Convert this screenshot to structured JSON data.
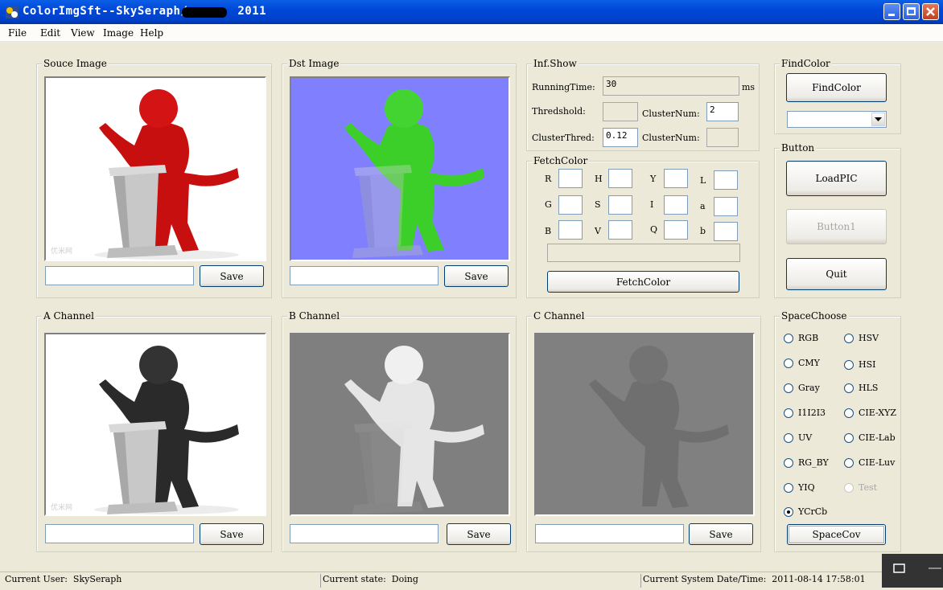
{
  "window": {
    "title_prefix": "ColorImgSft--SkySeraph/",
    "title_suffix": "2011"
  },
  "menu": [
    "File",
    "Edit",
    "View",
    "Image",
    "Help"
  ],
  "panels": {
    "source": {
      "label": "Souce Image",
      "save": "Save"
    },
    "dst": {
      "label": "Dst Image",
      "save": "Save"
    },
    "a": {
      "label": "A Channel",
      "save": "Save"
    },
    "b": {
      "label": "B Channel",
      "save": "Save"
    },
    "c": {
      "label": "C Channel",
      "save": "Save"
    }
  },
  "watermark": "优米网",
  "inf": {
    "label": "Inf.Show",
    "running_time_label": "RunningTime:",
    "running_time_value": "30",
    "running_time_unit": "ms",
    "threshold_label": "Thredshold:",
    "cluster_num_label": "ClusterNum:",
    "cluster_num_value": "2",
    "cluster_thred_label": "ClusterThred:",
    "cluster_thred_value": "0.12",
    "cluster_num2_label": "ClusterNum:"
  },
  "fetch": {
    "label": "FetchColor",
    "letters": [
      "R",
      "H",
      "Y",
      "L",
      "G",
      "S",
      "I",
      "a",
      "B",
      "V",
      "Q",
      "b"
    ],
    "button": "FetchColor"
  },
  "findcolor": {
    "label": "FindColor",
    "button": "FindColor"
  },
  "buttons": {
    "label": "Button",
    "load": "LoadPIC",
    "button1": "Button1",
    "quit": "Quit"
  },
  "space": {
    "label": "SpaceChoose",
    "options": [
      "RGB",
      "HSV",
      "CMY",
      "HSI",
      "Gray",
      "HLS",
      "I1I2I3",
      "CIE-XYZ",
      "UV",
      "CIE-Lab",
      "RG_BY",
      "CIE-Luv",
      "YIQ",
      "Test",
      "YCrCb"
    ],
    "selected": "YCrCb",
    "button": "SpaceCov"
  },
  "status": {
    "user_label": "Current User:",
    "user": "SkySeraph",
    "state_label": "Current state:",
    "state": "Doing",
    "datetime_label": "Current System Date/Time:",
    "datetime": "2011-08-14 17:58:01"
  },
  "colors": {
    "title_bar": "#0054e3",
    "dialog_bg": "#ece9d8",
    "dst_bg": "#8080ff",
    "channel_gray": "#7f7f7f",
    "figure_red": "#d01010",
    "figure_green": "#40d030"
  }
}
